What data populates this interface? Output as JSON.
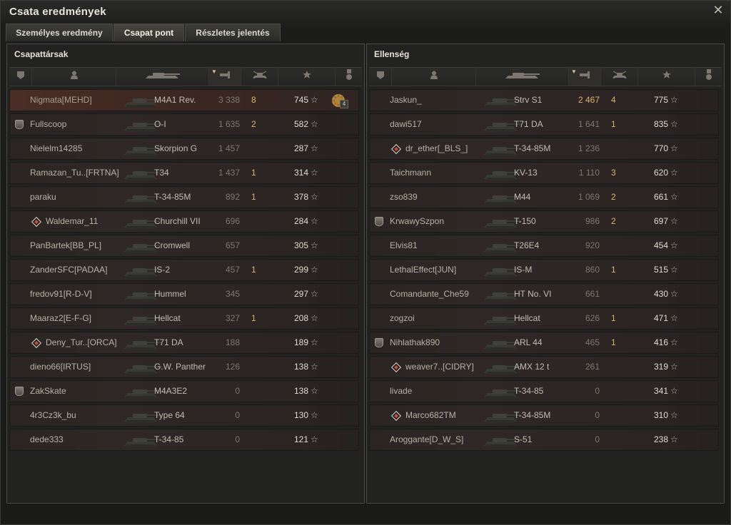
{
  "window": {
    "title": "Csata eredmények"
  },
  "tabs": [
    {
      "label": "Személyes eredmény",
      "active": false
    },
    {
      "label": "Csapat pont",
      "active": true
    },
    {
      "label": "Részletes jelentés",
      "active": false
    }
  ],
  "columns": [
    "clan-icon",
    "player-icon",
    "tank-icon",
    "xp-icon",
    "kills-icon",
    "points-icon",
    "medal-icon"
  ],
  "left": {
    "title": "Csapattársak",
    "rows": [
      {
        "name": "Nigmata[MEHD]",
        "tank": "M4A1 Rev.",
        "xp": "3 338",
        "kills": "8",
        "points": "745",
        "icon": "",
        "medal": "4",
        "highlight": true
      },
      {
        "name": "Fullscoop",
        "tank": "O-I",
        "xp": "1 635",
        "kills": "2",
        "points": "582",
        "icon": "clan"
      },
      {
        "name": "Nielelm14285",
        "tank": "Skorpion G",
        "xp": "1 457",
        "kills": "",
        "points": "287",
        "icon": ""
      },
      {
        "name": "Ramazan_Tu..[FRTNA]",
        "tank": "T34",
        "xp": "1 437",
        "kills": "1",
        "points": "314",
        "icon": ""
      },
      {
        "name": "paraku",
        "tank": "T-34-85M",
        "xp": "892",
        "kills": "1",
        "points": "378",
        "icon": ""
      },
      {
        "name": "Waldemar_11",
        "tank": "Churchill VII",
        "xp": "696",
        "kills": "",
        "points": "284",
        "icon": "diamond"
      },
      {
        "name": "PanBartek[BB_PL]",
        "tank": "Cromwell",
        "xp": "657",
        "kills": "",
        "points": "305",
        "icon": ""
      },
      {
        "name": "ZanderSFC[PADAA]",
        "tank": "IS-2",
        "xp": "457",
        "kills": "1",
        "points": "299",
        "icon": ""
      },
      {
        "name": "fredov91[R-D-V]",
        "tank": "Hummel",
        "xp": "345",
        "kills": "",
        "points": "297",
        "icon": ""
      },
      {
        "name": "Maaraz2[E-F-G]",
        "tank": "Hellcat",
        "xp": "327",
        "kills": "1",
        "points": "208",
        "icon": ""
      },
      {
        "name": "Deny_Tur..[ORCA]",
        "tank": "T71 DA",
        "xp": "188",
        "kills": "",
        "points": "189",
        "icon": "diamond"
      },
      {
        "name": "dieno66[IRTUS]",
        "tank": "G.W. Panther",
        "xp": "126",
        "kills": "",
        "points": "138",
        "icon": ""
      },
      {
        "name": "ZakSkate",
        "tank": "M4A3E2",
        "xp": "0",
        "kills": "",
        "points": "138",
        "icon": "clan"
      },
      {
        "name": "4r3Cz3k_bu",
        "tank": "Type 64",
        "xp": "0",
        "kills": "",
        "points": "130",
        "icon": ""
      },
      {
        "name": "dede333",
        "tank": "T-34-85",
        "xp": "0",
        "kills": "",
        "points": "121",
        "icon": ""
      }
    ]
  },
  "right": {
    "title": "Ellenség",
    "rows": [
      {
        "name": "Jaskun_",
        "tank": "Strv S1",
        "xp": "2 467",
        "kills": "4",
        "points": "775",
        "icon": "",
        "xp_bright": true
      },
      {
        "name": "dawi517",
        "tank": "T71 DA",
        "xp": "1 641",
        "kills": "1",
        "points": "835",
        "icon": ""
      },
      {
        "name": "dr_ether[_BLS_]",
        "tank": "T-34-85M",
        "xp": "1 236",
        "kills": "",
        "points": "770",
        "icon": "diamond"
      },
      {
        "name": "Taichmann",
        "tank": "KV-13",
        "xp": "1 110",
        "kills": "3",
        "points": "620",
        "icon": ""
      },
      {
        "name": "zso839",
        "tank": "M44",
        "xp": "1 069",
        "kills": "2",
        "points": "661",
        "icon": ""
      },
      {
        "name": "KrwawySzpon",
        "tank": "T-150",
        "xp": "986",
        "kills": "2",
        "points": "697",
        "icon": "clan"
      },
      {
        "name": "Elvis81",
        "tank": "T26E4",
        "xp": "920",
        "kills": "",
        "points": "454",
        "icon": ""
      },
      {
        "name": "LethalEffect[JUN]",
        "tank": "IS-M",
        "xp": "860",
        "kills": "1",
        "points": "515",
        "icon": ""
      },
      {
        "name": "Comandante_Che59",
        "tank": "HT No. VI",
        "xp": "661",
        "kills": "",
        "points": "430",
        "icon": ""
      },
      {
        "name": "zogzoi",
        "tank": "Hellcat",
        "xp": "626",
        "kills": "1",
        "points": "471",
        "icon": ""
      },
      {
        "name": "Nihlathak890",
        "tank": "ARL 44",
        "xp": "465",
        "kills": "1",
        "points": "416",
        "icon": "clan"
      },
      {
        "name": "weaver7..[CIDRY]",
        "tank": "AMX 12 t",
        "xp": "261",
        "kills": "",
        "points": "319",
        "icon": "diamond"
      },
      {
        "name": "livade",
        "tank": "T-34-85",
        "xp": "0",
        "kills": "",
        "points": "341",
        "icon": ""
      },
      {
        "name": "Marco682TM",
        "tank": "T-34-85M",
        "xp": "0",
        "kills": "",
        "points": "310",
        "icon": "diamond"
      },
      {
        "name": "Aroggante[D_W_S]",
        "tank": "S-51",
        "xp": "0",
        "kills": "",
        "points": "238",
        "icon": ""
      }
    ]
  },
  "star_glyph": "☆"
}
